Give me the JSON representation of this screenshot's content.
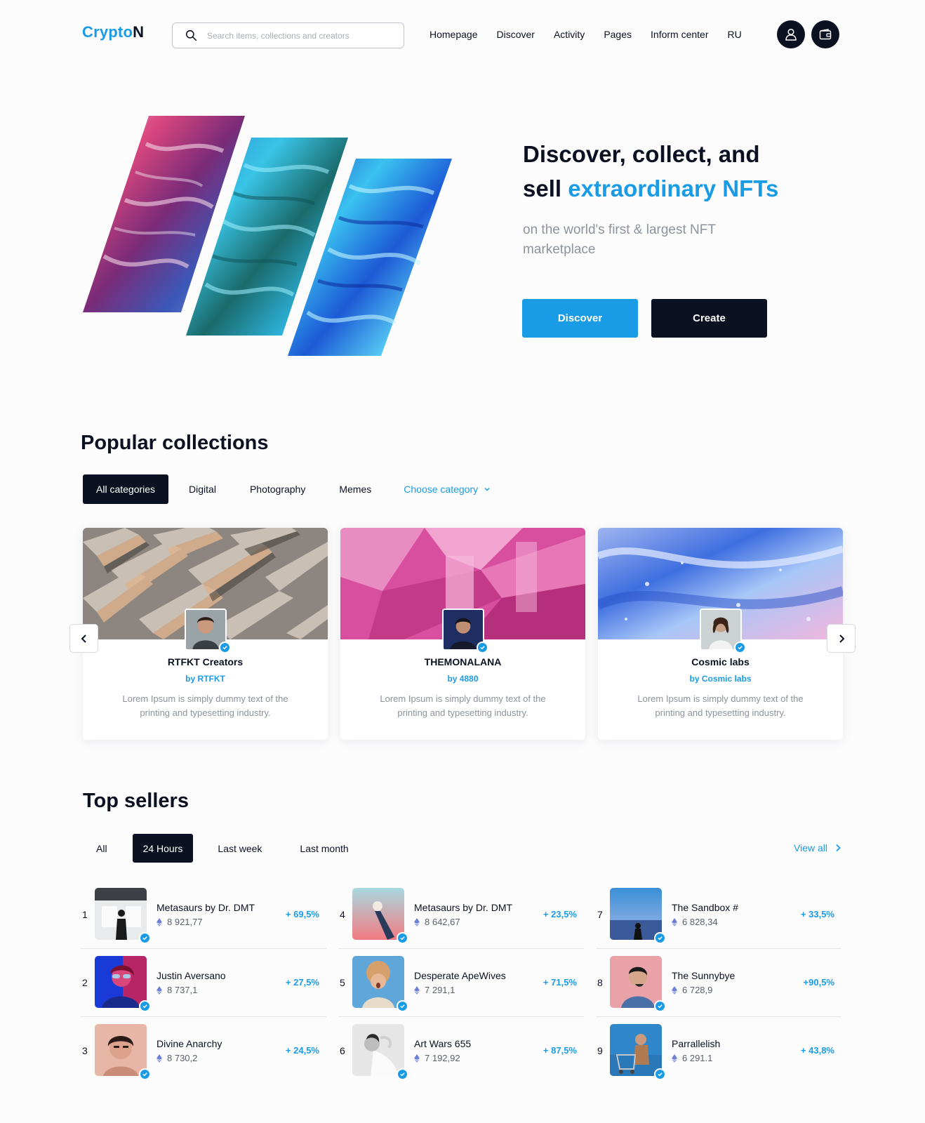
{
  "header": {
    "logo_part1": "Crypto",
    "logo_part2": "N",
    "search_placeholder": "Search items, collections and creators",
    "nav": [
      "Homepage",
      "Discover",
      "Activity",
      "Pages",
      "Inform center",
      "RU"
    ],
    "icons": [
      "user-icon",
      "wallet-icon"
    ]
  },
  "hero": {
    "title_line1": "Discover, collect, and",
    "title_word": "sell",
    "title_accent": "extraordinary NFTs",
    "subtitle": "on the world's first & largest NFT marketplace",
    "discover_label": "Discover",
    "create_label": "Create"
  },
  "popular": {
    "heading": "Popular collections",
    "tabs": [
      "All categories",
      "Digital",
      "Photography",
      "Memes",
      "Choose category"
    ],
    "active_tab": "All categories",
    "cards": [
      {
        "title": "RTFKT Creators",
        "by": "by RTFKT",
        "desc": "Lorem Ipsum is simply dummy text of the printing and typesetting industry."
      },
      {
        "title": "THEMONALANA",
        "by": "by 4880",
        "desc": "Lorem Ipsum is simply dummy text of the printing and typesetting industry."
      },
      {
        "title": "Cosmic labs",
        "by": "by Cosmic labs",
        "desc": "Lorem Ipsum is simply dummy text of the printing and typesetting industry."
      }
    ]
  },
  "sellers": {
    "heading": "Top sellers",
    "tabs": [
      "All",
      "24 Hours",
      "Last week",
      "Last month"
    ],
    "active_tab": "24 Hours",
    "view_all": "View all",
    "rows": [
      {
        "rank": "1",
        "name": "Metasaurs by Dr. DMT",
        "price": "8 921,77",
        "change": "+ 69,5%"
      },
      {
        "rank": "2",
        "name": "Justin Aversano",
        "price": "8 737,1",
        "change": "+ 27,5%"
      },
      {
        "rank": "3",
        "name": "Divine Anarchy",
        "price": "8 730,2",
        "change": "+ 24,5%"
      },
      {
        "rank": "4",
        "name": "Metasaurs by Dr. DMT",
        "price": "8 642,67",
        "change": "+ 23,5%"
      },
      {
        "rank": "5",
        "name": "Desperate ApeWives",
        "price": "7 291,1",
        "change": "+ 71,5%"
      },
      {
        "rank": "6",
        "name": "Art Wars 655",
        "price": "7 192,92",
        "change": "+ 87,5%"
      },
      {
        "rank": "7",
        "name": "The Sandbox #",
        "price": "6 828,34",
        "change": "+ 33,5%"
      },
      {
        "rank": "8",
        "name": "The Sunnybye",
        "price": "6 728,9",
        "change": "+90,5%"
      },
      {
        "rank": "9",
        "name": "Parrallelish",
        "price": "6 291.1",
        "change": "+ 43,8%"
      }
    ]
  },
  "colors": {
    "accent": "#1a9be6",
    "dark": "#0b1120",
    "muted": "#8d939c"
  }
}
